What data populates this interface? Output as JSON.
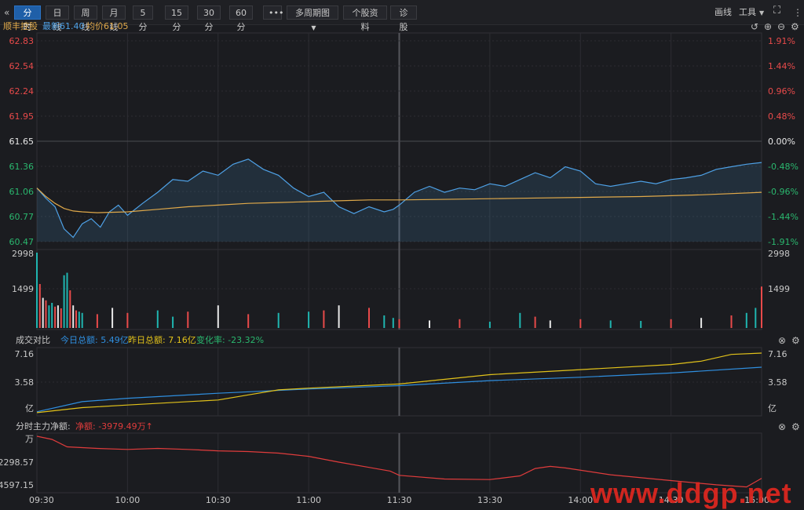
{
  "toolbar": {
    "collapse_icon": "double-chevron-left-icon",
    "tabs": [
      "分时",
      "日线",
      "周线",
      "月线",
      "5分",
      "15分",
      "30分",
      "60分"
    ],
    "more_label": "•••",
    "multi_period": "多周期图",
    "stock_info": "个股资料",
    "diagnose": "诊股",
    "draw_label": "画线",
    "tools_label": "工具"
  },
  "header": {
    "stock_name": "顺丰控股",
    "latest": "最新61.40",
    "avg": "均价61.05"
  },
  "volume_panel": {
    "top_label": "2998",
    "mid_label": "1499"
  },
  "compare_panel": {
    "title": "成交对比",
    "today": "今日总额: 5.49亿",
    "yesterday": "昨日总额: 7.16亿",
    "change": "变化率: -23.32%",
    "y_top": "7.16",
    "y_mid": "3.58",
    "unit": "亿"
  },
  "flow_panel": {
    "title": "分时主力净额:",
    "net": "净额: -3979.49万",
    "arrow": "↑",
    "unit": "万",
    "y1": "-2298.57",
    "y2": "-4597.15"
  },
  "watermark": "www.ddgp.net",
  "colors": {
    "price": "#4ea1e6",
    "avg": "#e0a94a",
    "up": "#e84a4a",
    "down": "#2ab76e",
    "cyan": "#1fb5b0",
    "today": "#2f8fe0",
    "yesterday": "#e2c21a",
    "flow": "#e03c3c"
  },
  "chart_data": [
    {
      "type": "line",
      "title": "顺丰控股",
      "x_ticks": [
        "09:30",
        "10:00",
        "10:30",
        "11:00",
        "11:30",
        "13:30",
        "14:00",
        "14:30",
        "15:00"
      ],
      "y_left_ticks": [
        "62.83",
        "62.54",
        "62.24",
        "61.95",
        "61.65",
        "61.36",
        "61.06",
        "60.77",
        "60.47"
      ],
      "y_right_ticks": [
        "1.91%",
        "1.44%",
        "0.96%",
        "0.48%",
        "0.00%",
        "-0.48%",
        "-0.96%",
        "-1.44%",
        "-1.91%"
      ],
      "ylim": [
        60.47,
        62.83
      ],
      "prev_close": 61.65,
      "series": [
        {
          "name": "最新",
          "x": [
            0,
            3,
            6,
            9,
            12,
            15,
            18,
            21,
            24,
            27,
            30,
            35,
            40,
            45,
            50,
            55,
            60,
            65,
            70,
            75,
            80,
            85,
            90,
            95,
            100,
            105,
            110,
            115,
            118,
            120,
            125,
            130,
            135,
            140,
            145,
            150,
            155,
            160,
            165,
            170,
            175,
            180,
            185,
            190,
            195,
            200,
            205,
            210,
            215,
            220,
            225,
            230,
            235,
            240
          ],
          "values": [
            61.1,
            60.98,
            60.88,
            60.62,
            60.52,
            60.68,
            60.74,
            60.64,
            60.82,
            60.9,
            60.78,
            60.92,
            61.05,
            61.2,
            61.18,
            61.3,
            61.25,
            61.38,
            61.44,
            61.32,
            61.25,
            61.1,
            61.0,
            61.05,
            60.88,
            60.8,
            60.88,
            60.82,
            60.85,
            60.9,
            61.05,
            61.12,
            61.05,
            61.1,
            61.08,
            61.15,
            61.12,
            61.2,
            61.28,
            61.22,
            61.35,
            61.3,
            61.15,
            61.12,
            61.15,
            61.18,
            61.15,
            61.2,
            61.22,
            61.25,
            61.32,
            61.35,
            61.38,
            61.4
          ]
        },
        {
          "name": "均价",
          "x": [
            0,
            3,
            6,
            9,
            12,
            15,
            20,
            30,
            40,
            50,
            60,
            70,
            80,
            90,
            100,
            110,
            120,
            140,
            160,
            180,
            200,
            220,
            240
          ],
          "values": [
            61.1,
            61.0,
            60.92,
            60.86,
            60.83,
            60.82,
            60.81,
            60.82,
            60.85,
            60.88,
            60.9,
            60.92,
            60.93,
            60.94,
            60.95,
            60.96,
            60.96,
            60.97,
            60.98,
            60.99,
            61.0,
            61.02,
            61.05
          ]
        }
      ]
    },
    {
      "type": "bar",
      "title": "",
      "ylim": [
        0,
        2998
      ],
      "y_ticks": [
        "2998",
        "1499"
      ],
      "series": [
        {
          "name": "",
          "x": [
            0,
            1,
            2,
            3,
            4,
            5,
            6,
            7,
            8,
            9,
            10,
            11,
            12,
            13,
            14,
            15,
            20,
            25,
            30,
            40,
            45,
            50,
            60,
            70,
            80,
            90,
            95,
            100,
            110,
            115,
            118,
            120,
            130,
            140,
            150,
            160,
            165,
            170,
            180,
            190,
            200,
            210,
            220,
            230,
            235,
            238,
            240
          ],
          "values": [
            2998,
            1750,
            1200,
            1100,
            900,
            1000,
            850,
            900,
            780,
            2100,
            2200,
            1500,
            900,
            700,
            650,
            600,
            550,
            800,
            600,
            700,
            450,
            650,
            900,
            550,
            600,
            650,
            700,
            900,
            800,
            500,
            400,
            350,
            300,
            350,
            250,
            600,
            450,
            300,
            350,
            300,
            280,
            350,
            400,
            500,
            600,
            800,
            1650
          ]
        }
      ]
    },
    {
      "type": "line",
      "title": "成交对比",
      "ylim": [
        0,
        7.16
      ],
      "y_ticks": [
        "7.16",
        "3.58"
      ],
      "series": [
        {
          "name": "今日总额",
          "x": [
            0,
            15,
            30,
            60,
            90,
            120,
            150,
            180,
            210,
            240
          ],
          "values": [
            0.2,
            1.4,
            1.8,
            2.4,
            2.9,
            3.3,
            3.9,
            4.3,
            4.8,
            5.49
          ]
        },
        {
          "name": "昨日总额",
          "x": [
            0,
            15,
            30,
            60,
            70,
            80,
            90,
            120,
            150,
            180,
            210,
            220,
            230,
            240
          ],
          "values": [
            0.1,
            0.7,
            1.0,
            1.6,
            2.2,
            2.8,
            3.0,
            3.5,
            4.6,
            5.2,
            5.8,
            6.2,
            7.0,
            7.16
          ]
        }
      ]
    },
    {
      "type": "line",
      "title": "分时主力净额",
      "ylim": [
        -5200,
        0
      ],
      "y_ticks": [
        "-2298.57",
        "-4597.15"
      ],
      "series": [
        {
          "name": "净额",
          "x": [
            0,
            5,
            10,
            20,
            30,
            40,
            50,
            60,
            70,
            80,
            90,
            100,
            110,
            117,
            120,
            135,
            150,
            160,
            165,
            170,
            175,
            190,
            210,
            225,
            235,
            240
          ],
          "values": [
            0,
            -300,
            -1000,
            -1150,
            -1250,
            -1150,
            -1250,
            -1380,
            -1450,
            -1600,
            -1900,
            -2450,
            -2950,
            -3300,
            -3700,
            -4050,
            -4100,
            -3750,
            -3050,
            -2850,
            -3000,
            -3650,
            -4200,
            -4600,
            -4800,
            -3979
          ]
        }
      ]
    }
  ]
}
